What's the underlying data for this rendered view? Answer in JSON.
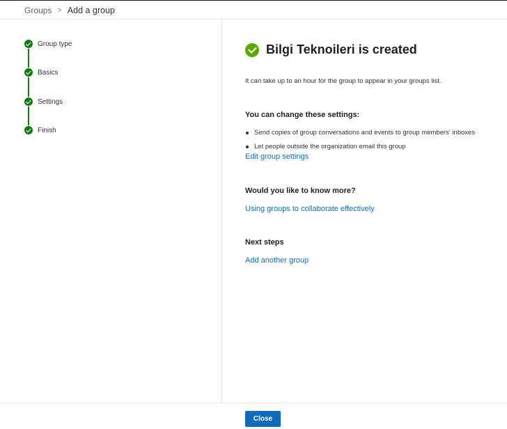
{
  "breadcrumb": {
    "parent": "Groups",
    "separator": ">",
    "current": "Add a group"
  },
  "steps": [
    {
      "label": "Group type",
      "status": "complete"
    },
    {
      "label": "Basics",
      "status": "complete"
    },
    {
      "label": "Settings",
      "status": "complete"
    },
    {
      "label": "Finish",
      "status": "complete"
    }
  ],
  "main": {
    "title": "Bilgi Teknoileri is created",
    "info": "It can take up to an hour for the group to appear in your groups list.",
    "settings_heading": "You can change these settings:",
    "settings_bullets": [
      "Send copies of group conversations and events to group members' inboxes",
      "Let people outside the organization email this group"
    ],
    "edit_link": "Edit group settings",
    "learn_heading": "Would you like to know more?",
    "learn_link": "Using groups to collaborate effectively",
    "next_heading": "Next steps",
    "next_link": "Add another group"
  },
  "footer": {
    "close_label": "Close"
  },
  "colors": {
    "accent": "#0f6cbd",
    "success": "#107c10",
    "title_check": "#5ca800"
  },
  "icons": {
    "step": "checkmark-circle-icon",
    "title": "checkmark-circle-icon"
  }
}
